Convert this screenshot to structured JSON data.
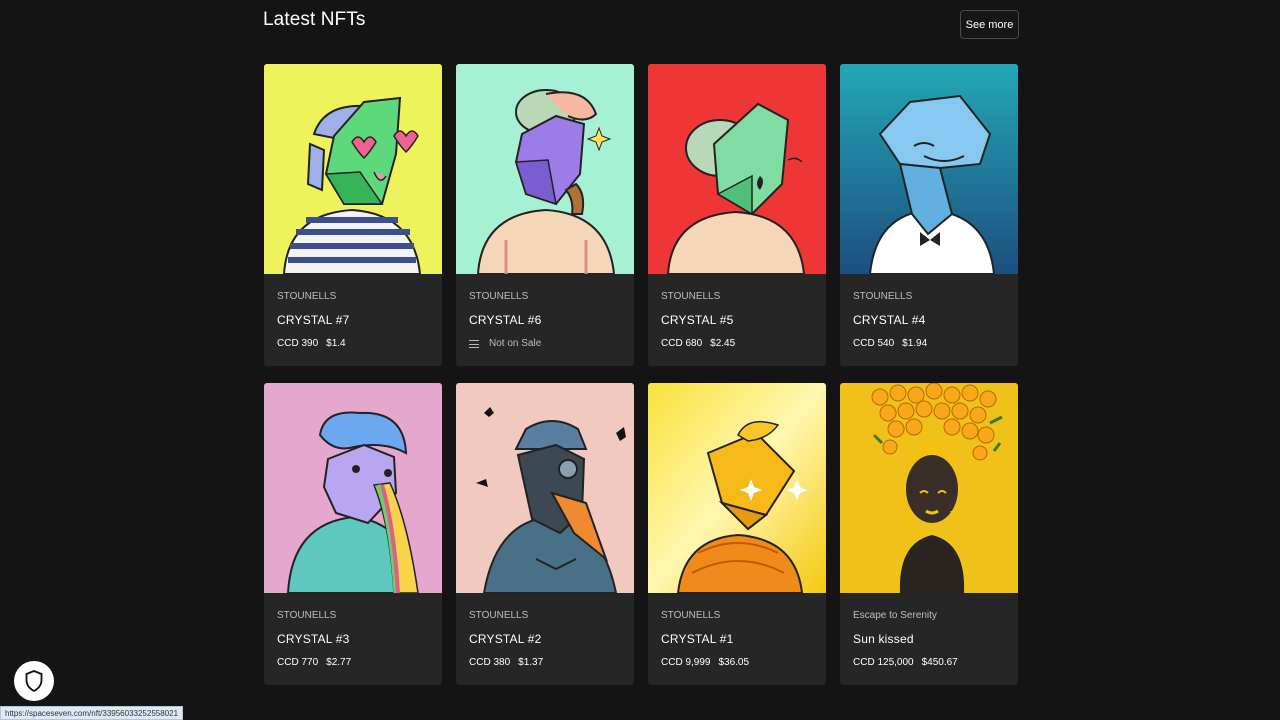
{
  "header": {
    "title": "Latest NFTs",
    "see_more_label": "See more"
  },
  "cards": [
    {
      "collection": "STOUNELLS",
      "name": "CRYSTAL #7",
      "ccd": "CCD 390",
      "usd": "$1.4",
      "bg": "#eef35c",
      "art": "crystal-bandana"
    },
    {
      "collection": "STOUNELLS",
      "name": "CRYSTAL #6",
      "status": "Not on Sale",
      "bg": "#a6f0d3",
      "art": "crystal-pipe"
    },
    {
      "collection": "STOUNELLS",
      "name": "CRYSTAL #5",
      "ccd": "CCD 680",
      "usd": "$2.45",
      "bg": "#ee3636",
      "art": "crystal-brain"
    },
    {
      "collection": "STOUNELLS",
      "name": "CRYSTAL #4",
      "ccd": "CCD 540",
      "usd": "$1.94",
      "bg": "#1f7f98",
      "art": "crystal-whale"
    },
    {
      "collection": "STOUNELLS",
      "name": "CRYSTAL #3",
      "ccd": "CCD 770",
      "usd": "$2.77",
      "bg": "#e6a7cf",
      "art": "crystal-rainbow"
    },
    {
      "collection": "STOUNELLS",
      "name": "CRYSTAL #2",
      "ccd": "CCD 380",
      "usd": "$1.37",
      "bg": "#f2c9bf",
      "art": "crystal-plague-doctor"
    },
    {
      "collection": "STOUNELLS",
      "name": "CRYSTAL #1",
      "ccd": "CCD 9,999",
      "usd": "$36.05",
      "bg": "#f7d315",
      "art": "crystal-gold"
    },
    {
      "collection": "Escape to Serenity",
      "name": "Sun kissed",
      "ccd": "CCD 125,000",
      "usd": "$450.67",
      "bg": "#f0c118",
      "art": "sun-kissed-portrait"
    }
  ],
  "privacy_button": {
    "icon": "shield-icon"
  },
  "status_bar": {
    "url": "https://spaceseven.com/nft/3395603325255802​1"
  }
}
